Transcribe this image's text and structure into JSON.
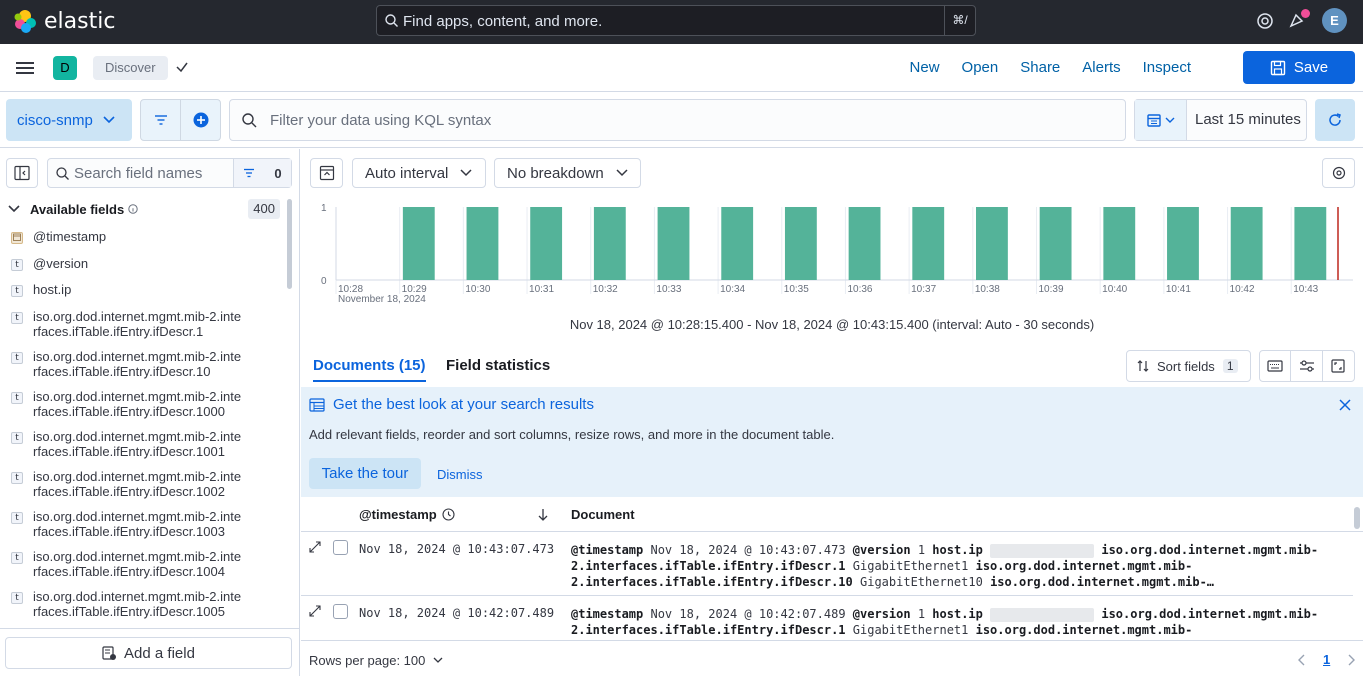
{
  "topbar": {
    "logo_text": "elastic",
    "search_placeholder": "Find apps, content, and more.",
    "search_shortcut": "⌘/",
    "avatar_initial": "E"
  },
  "appbar": {
    "space_initial": "D",
    "breadcrumb": "Discover",
    "links": [
      "New",
      "Open",
      "Share",
      "Alerts",
      "Inspect"
    ],
    "save_label": "Save"
  },
  "querybar": {
    "data_view": "cisco-snmp",
    "kql_placeholder": "Filter your data using KQL syntax",
    "time_range": "Last 15 minutes"
  },
  "sidebar": {
    "search_placeholder": "Search field names",
    "filter_count": "0",
    "available_label": "Available fields",
    "available_count": "400",
    "fields": [
      {
        "type": "date",
        "name": "@timestamp"
      },
      {
        "type": "t",
        "name": "@version"
      },
      {
        "type": "t",
        "name": "host.ip"
      },
      {
        "type": "t",
        "name": "iso.org.dod.internet.mgmt.mib-2.interfaces.ifTable.ifEntry.ifDescr.1"
      },
      {
        "type": "t",
        "name": "iso.org.dod.internet.mgmt.mib-2.interfaces.ifTable.ifEntry.ifDescr.10"
      },
      {
        "type": "t",
        "name": "iso.org.dod.internet.mgmt.mib-2.interfaces.ifTable.ifEntry.ifDescr.1000"
      },
      {
        "type": "t",
        "name": "iso.org.dod.internet.mgmt.mib-2.interfaces.ifTable.ifEntry.ifDescr.1001"
      },
      {
        "type": "t",
        "name": "iso.org.dod.internet.mgmt.mib-2.interfaces.ifTable.ifEntry.ifDescr.1002"
      },
      {
        "type": "t",
        "name": "iso.org.dod.internet.mgmt.mib-2.interfaces.ifTable.ifEntry.ifDescr.1003"
      },
      {
        "type": "t",
        "name": "iso.org.dod.internet.mgmt.mib-2.interfaces.ifTable.ifEntry.ifDescr.1004"
      },
      {
        "type": "t",
        "name": "iso.org.dod.internet.mgmt.mib-2.interfaces.ifTable.ifEntry.ifDescr.1005"
      }
    ],
    "add_field_label": "Add a field"
  },
  "chart_toolbar": {
    "interval": "Auto interval",
    "breakdown": "No breakdown"
  },
  "chart_data": {
    "type": "bar",
    "x": [
      "10:28",
      "10:29",
      "10:30",
      "10:31",
      "10:32",
      "10:33",
      "10:34",
      "10:35",
      "10:36",
      "10:37",
      "10:38",
      "10:39",
      "10:40",
      "10:41",
      "10:42",
      "10:43"
    ],
    "values": [
      0,
      1,
      1,
      1,
      1,
      1,
      1,
      1,
      1,
      1,
      1,
      1,
      1,
      1,
      1,
      1
    ],
    "ylim": [
      0,
      1
    ],
    "yticks": [
      "1",
      "0"
    ],
    "date_label": "November 18, 2024",
    "bar_color": "#54b399",
    "marker_color": "#bd271e"
  },
  "interval_text": "Nov 18, 2024 @ 10:28:15.400 - Nov 18, 2024 @ 10:43:15.400 (interval: Auto - 30 seconds)",
  "tabs": {
    "documents": "Documents (15)",
    "field_stats": "Field statistics",
    "sort_label": "Sort fields",
    "sort_count": "1"
  },
  "callout": {
    "title": "Get the best look at your search results",
    "description": "Add relevant fields, reorder and sort columns, resize rows, and more in the document table.",
    "tour_label": "Take the tour",
    "dismiss_label": "Dismiss"
  },
  "grid": {
    "col_timestamp": "@timestamp",
    "col_document": "Document",
    "rows": [
      {
        "timestamp": "Nov 18, 2024 @ 10:43:07.473",
        "doc_ts": "Nov 18, 2024 @ 10:43:07.473",
        "version": "1",
        "line2_key": "2.interfaces.ifTable.ifEntry.ifDescr.1",
        "line2_val": "GigabitEthernet1",
        "line3_key": "2.interfaces.ifTable.ifEntry.ifDescr.10",
        "line3_val": "GigabitEthernet10"
      },
      {
        "timestamp": "Nov 18, 2024 @ 10:42:07.489",
        "doc_ts": "Nov 18, 2024 @ 10:42:07.489",
        "version": "1",
        "line2_key": "2.interfaces.ifTable.ifEntry.ifDescr.1",
        "line2_val": "GigabitEthernet1"
      }
    ],
    "k_timestamp": "@timestamp",
    "k_version": "@version",
    "k_hostip": "host.ip",
    "k_mib_prefix": "iso.org.dod.internet.mgmt.mib-",
    "k_mib_trunc": "iso.org.dod.internet.mgmt.mib-…"
  },
  "footer": {
    "rows_per_page": "Rows per page: 100",
    "page": "1"
  }
}
